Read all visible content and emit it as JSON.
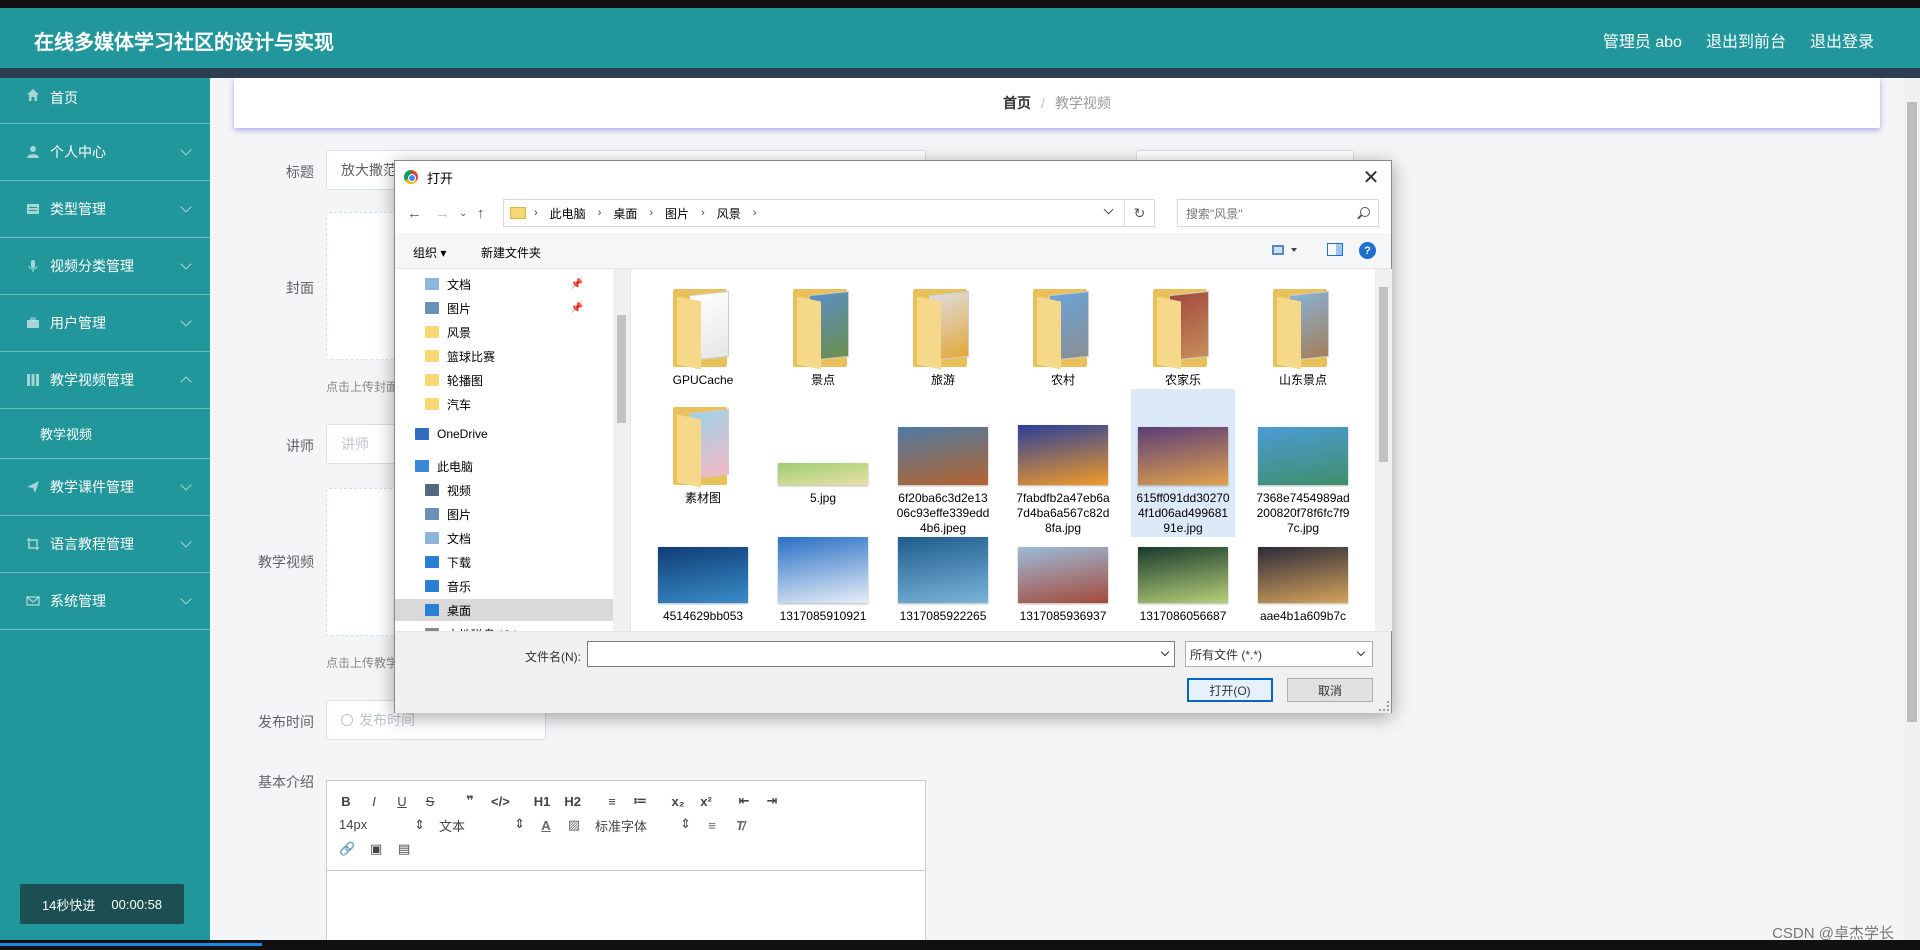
{
  "header": {
    "title": "在线多媒体学习社区的设计与实现",
    "admin": "管理员 abo",
    "to_front": "退出到前台",
    "logout": "退出登录"
  },
  "sidebar": {
    "items": [
      {
        "label": "首页",
        "icon": "home-icon"
      },
      {
        "label": "个人中心",
        "icon": "user-icon"
      },
      {
        "label": "类型管理",
        "icon": "list-icon"
      },
      {
        "label": "视频分类管理",
        "icon": "mic-icon"
      },
      {
        "label": "用户管理",
        "icon": "briefcase-icon"
      },
      {
        "label": "教学视频管理",
        "icon": "grid-icon"
      },
      {
        "label": "教学视频",
        "icon": ""
      },
      {
        "label": "教学课件管理",
        "icon": "send-icon"
      },
      {
        "label": "语言教程管理",
        "icon": "crop-icon"
      },
      {
        "label": "系统管理",
        "icon": "mail-icon"
      }
    ],
    "timer_label": "14秒快进",
    "timer_time": "00:00:58"
  },
  "breadcrumb": {
    "home": "首页",
    "sep": "/",
    "current": "教学视频"
  },
  "form": {
    "title_label": "标题",
    "title_value": "放大撒范",
    "cover_label": "封面",
    "cover_hint": "点击上传封面",
    "teacher_label": "讲师",
    "teacher_placeholder": "讲师",
    "video_label": "教学视频",
    "video_hint": "点击上传教学",
    "time_label": "发布时间",
    "time_placeholder": "发布时间",
    "intro_label": "基本介绍"
  },
  "editor": {
    "row1": [
      "B",
      "I",
      "U",
      "S",
      "❞",
      "</>",
      "H1",
      "H2",
      "≡",
      "≔",
      "x₂",
      "x²",
      "⇤",
      "⇥"
    ],
    "font_size": "14px",
    "text_style": "文本",
    "font_family": "标准字体"
  },
  "dialog": {
    "title": "打开",
    "path": [
      "此电脑",
      "桌面",
      "图片",
      "风景"
    ],
    "search_placeholder": "搜索\"风景\"",
    "organize": "组织 ▾",
    "new_folder": "新建文件夹",
    "nav": [
      {
        "label": "文档",
        "pinned": true,
        "color": "#8fb4dd"
      },
      {
        "label": "图片",
        "pinned": true,
        "color": "#6a8fb9"
      },
      {
        "label": "风景",
        "color": "#f7d774"
      },
      {
        "label": "篮球比赛",
        "color": "#f7d774"
      },
      {
        "label": "轮播图",
        "color": "#f7d774"
      },
      {
        "label": "汽车",
        "color": "#f7d774"
      },
      {
        "label": "OneDrive",
        "color": "#2f6bbf"
      },
      {
        "label": "此电脑",
        "color": "#3a86d6"
      },
      {
        "label": "视频",
        "color": "#55687f"
      },
      {
        "label": "图片",
        "color": "#6a8fb9"
      },
      {
        "label": "文档",
        "color": "#8fb4dd"
      },
      {
        "label": "下载",
        "color": "#2a7fd4"
      },
      {
        "label": "音乐",
        "color": "#2a7fd4"
      },
      {
        "label": "桌面",
        "color": "#2a7fd4",
        "selected": true
      },
      {
        "label": "本地磁盘 (C:)",
        "color": "#888888"
      }
    ],
    "files": [
      {
        "name": "GPUCache",
        "kind": "folder",
        "c1": "#ffffff",
        "c2": "#e6e6e6"
      },
      {
        "name": "景点",
        "kind": "folder",
        "c1": "#5a8fc4",
        "c2": "#6b8e4e"
      },
      {
        "name": "旅游",
        "kind": "folder",
        "c1": "#dcdcdc",
        "c2": "#e3a83a"
      },
      {
        "name": "农村",
        "kind": "folder",
        "c1": "#6aa3d8",
        "c2": "#8a8f94"
      },
      {
        "name": "农家乐",
        "kind": "folder",
        "c1": "#a34b3e",
        "c2": "#c58d5a"
      },
      {
        "name": "山东景点",
        "kind": "folder",
        "c1": "#87b1d6",
        "c2": "#a37f5a"
      },
      {
        "name": "素材图",
        "kind": "folder",
        "c1": "#9fd3e6",
        "c2": "#f2b8c6"
      },
      {
        "name": "5.jpg",
        "kind": "image",
        "c1": "#9fcd72",
        "c2": "#e8e2a6",
        "h": 22
      },
      {
        "name": "6f20ba6c3d2e1306c93effe339edd4b6.jpeg",
        "kind": "image",
        "c1": "#4f7aa3",
        "c2": "#b5632f",
        "h": 58
      },
      {
        "name": "7fabdfb2a47eb6a7d4ba6a567c82d8fa.jpg",
        "kind": "image",
        "c1": "#2a3f9a",
        "c2": "#f29a28",
        "h": 60
      },
      {
        "name": "615ff091dd302704f1d06ad49968191e.jpg",
        "kind": "image",
        "c1": "#5a3d7a",
        "c2": "#e2a24a",
        "h": 58,
        "selected": true
      },
      {
        "name": "7368e7454989ad200820f78f6fc7f97c.jpg",
        "kind": "image",
        "c1": "#4c9bd6",
        "c2": "#3f8f6b",
        "h": 58
      },
      {
        "name": "4514629bb053",
        "kind": "image",
        "c1": "#0f3d75",
        "c2": "#3a8cc9",
        "h": 56
      },
      {
        "name": "1317085910921",
        "kind": "image",
        "c1": "#2a70c4",
        "c2": "#e6eef7",
        "h": 66
      },
      {
        "name": "1317085922265",
        "kind": "image",
        "c1": "#1f5c8c",
        "c2": "#79b4d8",
        "h": 66
      },
      {
        "name": "1317085936937",
        "kind": "image",
        "c1": "#9bbcd9",
        "c2": "#a54a3a",
        "h": 56
      },
      {
        "name": "1317086056687",
        "kind": "image",
        "c1": "#183a2b",
        "c2": "#b7d07a",
        "h": 56
      },
      {
        "name": "aae4b1a609b7c",
        "kind": "image",
        "c1": "#2b2b3a",
        "c2": "#d6a35a",
        "h": 56
      }
    ],
    "filename_label": "文件名(N):",
    "filetype": "所有文件 (*.*)",
    "open_btn": "打开(O)",
    "cancel_btn": "取消"
  },
  "watermark": "CSDN @卓杰学长",
  "colors": {
    "accent": "#22979b",
    "dark": "#2d3e50"
  }
}
